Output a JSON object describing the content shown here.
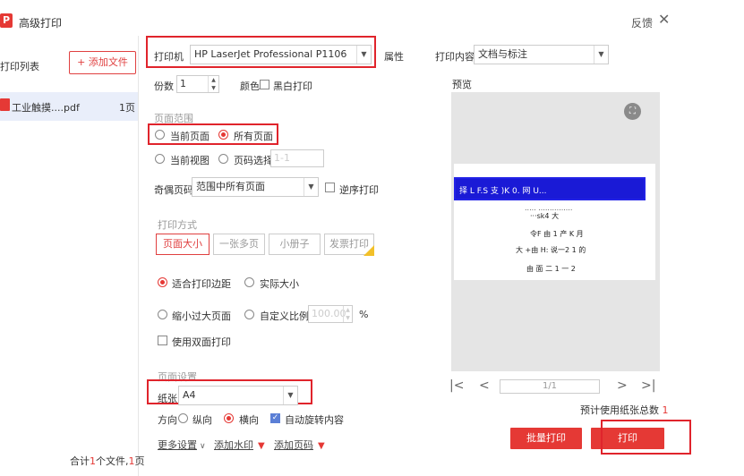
{
  "app": {
    "logo": "P",
    "title": "高级打印",
    "feedback": "反馈",
    "close": "✕"
  },
  "left": {
    "list_title": "打印列表",
    "add_file": "+ 添加文件",
    "files": [
      {
        "name": "工业触摸....pdf",
        "pages": "1页"
      }
    ],
    "total_prefix": "合计",
    "total_files": "1",
    "total_mid": "个文件,",
    "total_pages": "1",
    "total_suffix": "页"
  },
  "printer": {
    "label": "打印机",
    "value": "HP LaserJet Professional P1106",
    "properties": "属性"
  },
  "copies": {
    "label": "份数",
    "value": "1"
  },
  "color": {
    "label": "颜色",
    "bw_label": "黑白打印"
  },
  "range": {
    "title": "页面范围",
    "current_page": "当前页面",
    "all_pages": "所有页面",
    "current_view": "当前视图",
    "page_select": "页码选择",
    "page_select_placeholder": "1-1"
  },
  "odd_even": {
    "label": "奇偶页码",
    "value": "范围中所有页面",
    "reverse": "逆序打印"
  },
  "mode": {
    "title": "打印方式",
    "tabs": [
      "页面大小",
      "一张多页",
      "小册子",
      "发票打印"
    ],
    "fit_margin": "适合打印边距",
    "actual_size": "实际大小",
    "shrink": "缩小过大页面",
    "custom_scale": "自定义比例",
    "custom_scale_value": "100.00",
    "percent": "%",
    "duplex": "使用双面打印"
  },
  "page_setup": {
    "title": "页面设置",
    "paper_label": "纸张",
    "paper_value": "A4",
    "orientation_label": "方向",
    "portrait": "纵向",
    "landscape": "横向",
    "auto_rotate": "自动旋转内容"
  },
  "links": {
    "more": "更多设置",
    "watermark": "添加水印",
    "page_number": "添加页码"
  },
  "print_content": {
    "label": "打印内容",
    "value": "文档与标注"
  },
  "preview": {
    "title": "预览",
    "page_indicator": "1/1",
    "lines": [
      "择 L F.S 支 )K 0. 网 U...",
      "..... ...............",
      "···sk4 大",
      "令F 由 1 产 K 月",
      "大 +由 H: 说一2 1 的",
      "由 面 二 1 一 2 "
    ],
    "first": "|<",
    "prev": "<",
    "next": ">",
    "last": ">|"
  },
  "paper_total": {
    "label": "预计使用纸张总数",
    "value": "1"
  },
  "buttons": {
    "batch_print": "批量打印",
    "print": "打印"
  },
  "colors": {
    "accent": "#e53935",
    "highlight_box": "#e0242c",
    "selection_bg": "#e9eefa"
  }
}
